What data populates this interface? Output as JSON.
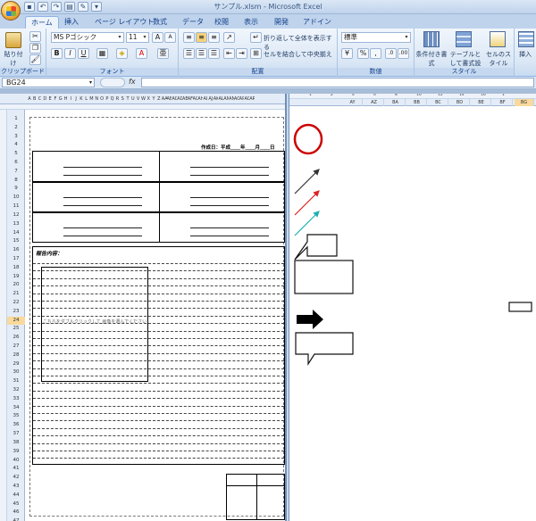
{
  "title_bar": {
    "title": "サンプル.xlsm - Microsoft Excel"
  },
  "tabs": [
    {
      "label": "ホーム",
      "active": true
    },
    {
      "label": "挿入"
    },
    {
      "label": "ページ レイアウト"
    },
    {
      "label": "数式"
    },
    {
      "label": "データ"
    },
    {
      "label": "校閲"
    },
    {
      "label": "表示"
    },
    {
      "label": "開発"
    },
    {
      "label": "アドイン"
    }
  ],
  "ribbon": {
    "clipboard": {
      "paste_label": "貼り付け",
      "group_label": "クリップボード"
    },
    "font": {
      "font_name": "MS Pゴシック",
      "font_size": "11",
      "bold": "B",
      "italic": "I",
      "underline": "U",
      "group_label": "フォント"
    },
    "alignment": {
      "wrap_text": "折り返して全体を表示する",
      "merge_center": "セルを結合して中央揃え",
      "group_label": "配置"
    },
    "number": {
      "format": "標準",
      "group_label": "数値"
    },
    "styles": {
      "conditional": "条件付き書式",
      "as_table": "テーブルとして書式設定",
      "cell_styles": "セルのスタイル",
      "group_label": "スタイル"
    },
    "cells": {
      "insert": "挿入"
    }
  },
  "formula_bar": {
    "name_box": "BG24",
    "fx": "fx",
    "formula": ""
  },
  "left_pane": {
    "column_headers": [
      "A",
      "B",
      "C",
      "D",
      "E",
      "F",
      "G",
      "H",
      "I",
      "J",
      "K",
      "L",
      "M",
      "N",
      "O",
      "P",
      "Q",
      "R",
      "S",
      "T",
      "U",
      "V",
      "W",
      "X",
      "Y",
      "Z",
      "AA",
      "AB",
      "AC",
      "AD",
      "AE",
      "AF",
      "AG",
      "AH",
      "AI",
      "AJ",
      "AK",
      "AL",
      "AM",
      "AN",
      "AO",
      "AP",
      "AQ",
      "AR"
    ],
    "row_numbers": [
      "1",
      "2",
      "3",
      "4",
      "5",
      "6",
      "7",
      "8",
      "9",
      "10",
      "11",
      "12",
      "13",
      "14",
      "15",
      "16",
      "17",
      "18",
      "19",
      "20",
      "21",
      "22",
      "23",
      "24",
      "25",
      "26",
      "27",
      "28",
      "29",
      "30",
      "31",
      "32",
      "33",
      "34",
      "35",
      "36",
      "37",
      "38",
      "39",
      "40",
      "41",
      "42",
      "43",
      "44",
      "45",
      "46",
      "47"
    ],
    "selected_row": "24",
    "date_line": "作成日：平成＿＿年＿＿月＿＿日",
    "report_label": "報告内容：",
    "photo_placeholder": "こちらをダブルクリックして 画像を選んでください"
  },
  "right_pane": {
    "ruler_marks": [
      "1",
      "2",
      "4",
      "6",
      "8",
      "10",
      "12",
      "14",
      "16",
      "1"
    ],
    "column_headers": [
      "AY",
      "AZ",
      "BA",
      "BB",
      "BC",
      "BD",
      "BE",
      "BF",
      "BG"
    ],
    "selected_column": "BG"
  },
  "colors": {
    "accent": "#2b78e4",
    "circle": "#cc0000",
    "arrow_red": "#e02020",
    "arrow_teal": "#20b0b0"
  }
}
